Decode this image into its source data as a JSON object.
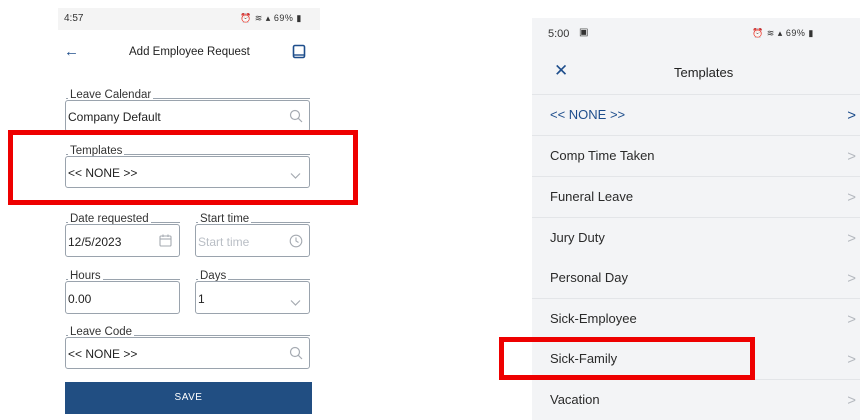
{
  "left": {
    "status": {
      "time": "4:57",
      "icons_text": "69%"
    },
    "header": {
      "title": "Add Employee Request"
    },
    "fields": {
      "leave_calendar": {
        "label": "Leave Calendar",
        "value": "Company Default"
      },
      "templates": {
        "label": "Templates",
        "value": "<< NONE >>"
      },
      "date_requested": {
        "label": "Date requested",
        "value": "12/5/2023"
      },
      "start_time": {
        "label": "Start time",
        "placeholder": "Start time"
      },
      "hours": {
        "label": "Hours",
        "value": "0.00"
      },
      "days": {
        "label": "Days",
        "value": "1"
      },
      "leave_code": {
        "label": "Leave Code",
        "value": "<< NONE >>"
      }
    },
    "save_label": "SAVE"
  },
  "right": {
    "status": {
      "time": "5:00",
      "icons_text": "69%"
    },
    "header": {
      "title": "Templates"
    },
    "items": [
      {
        "label": "<< NONE >>",
        "selected": true
      },
      {
        "label": "Comp Time Taken"
      },
      {
        "label": "Funeral Leave"
      },
      {
        "label": "Jury Duty"
      },
      {
        "label": "Personal Day"
      },
      {
        "label": "Sick-Employee"
      },
      {
        "label": "Sick-Family"
      },
      {
        "label": "Vacation"
      }
    ]
  },
  "colors": {
    "accent": "#214e82",
    "highlight": "#ee0000"
  }
}
